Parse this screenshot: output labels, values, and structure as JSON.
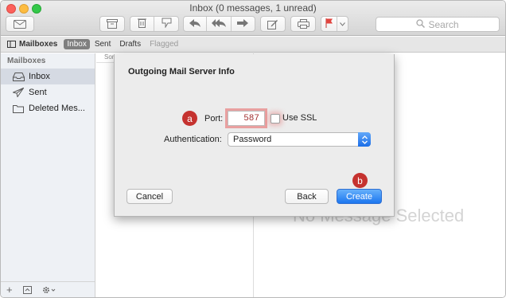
{
  "window": {
    "title": "Inbox (0 messages, 1 unread)"
  },
  "toolbar": {
    "buttons": [
      {
        "icon": "compose-envelope-icon"
      },
      {
        "icon": "archive-icon"
      },
      {
        "icon": "trash-icon"
      },
      {
        "icon": "junk-icon"
      },
      {
        "icon": "reply-icon"
      },
      {
        "icon": "reply-all-icon"
      },
      {
        "icon": "forward-icon"
      },
      {
        "icon": "new-message-icon"
      },
      {
        "icon": "print-icon"
      },
      {
        "icon": "flag-icon",
        "color": "#e0443e"
      }
    ],
    "search": {
      "placeholder": "Search"
    }
  },
  "favorites_bar": {
    "mailboxes_label": "Mailboxes",
    "items": [
      {
        "label": "Inbox",
        "selected": true
      },
      {
        "label": "Sent"
      },
      {
        "label": "Drafts"
      },
      {
        "label": "Flagged",
        "muted": true
      }
    ]
  },
  "sidebar": {
    "header": "Mailboxes",
    "items": [
      {
        "label": "Inbox",
        "icon": "inbox-tray-icon",
        "selected": true
      },
      {
        "label": "Sent",
        "icon": "paper-plane-icon"
      },
      {
        "label": "Deleted Mes...",
        "icon": "folder-icon"
      }
    ],
    "footer": [
      "+",
      "inbox-toggle-icon",
      "gear-icon"
    ]
  },
  "message_list": {
    "sort_header": "Sor"
  },
  "viewer": {
    "empty_text": "No Message Selected"
  },
  "sheet": {
    "title": "Outgoing Mail Server Info",
    "port_label": "Port:",
    "port_value": "587",
    "use_ssl_label": "Use SSL",
    "use_ssl_checked": false,
    "auth_label": "Authentication:",
    "auth_value": "Password",
    "buttons": {
      "cancel": "Cancel",
      "back": "Back",
      "create": "Create"
    }
  },
  "markers": {
    "a": "a",
    "b": "b"
  },
  "colors": {
    "accent_blue": "#1c76ef",
    "marker_red": "#c5322f",
    "ssl_highlight": "#e76363"
  }
}
